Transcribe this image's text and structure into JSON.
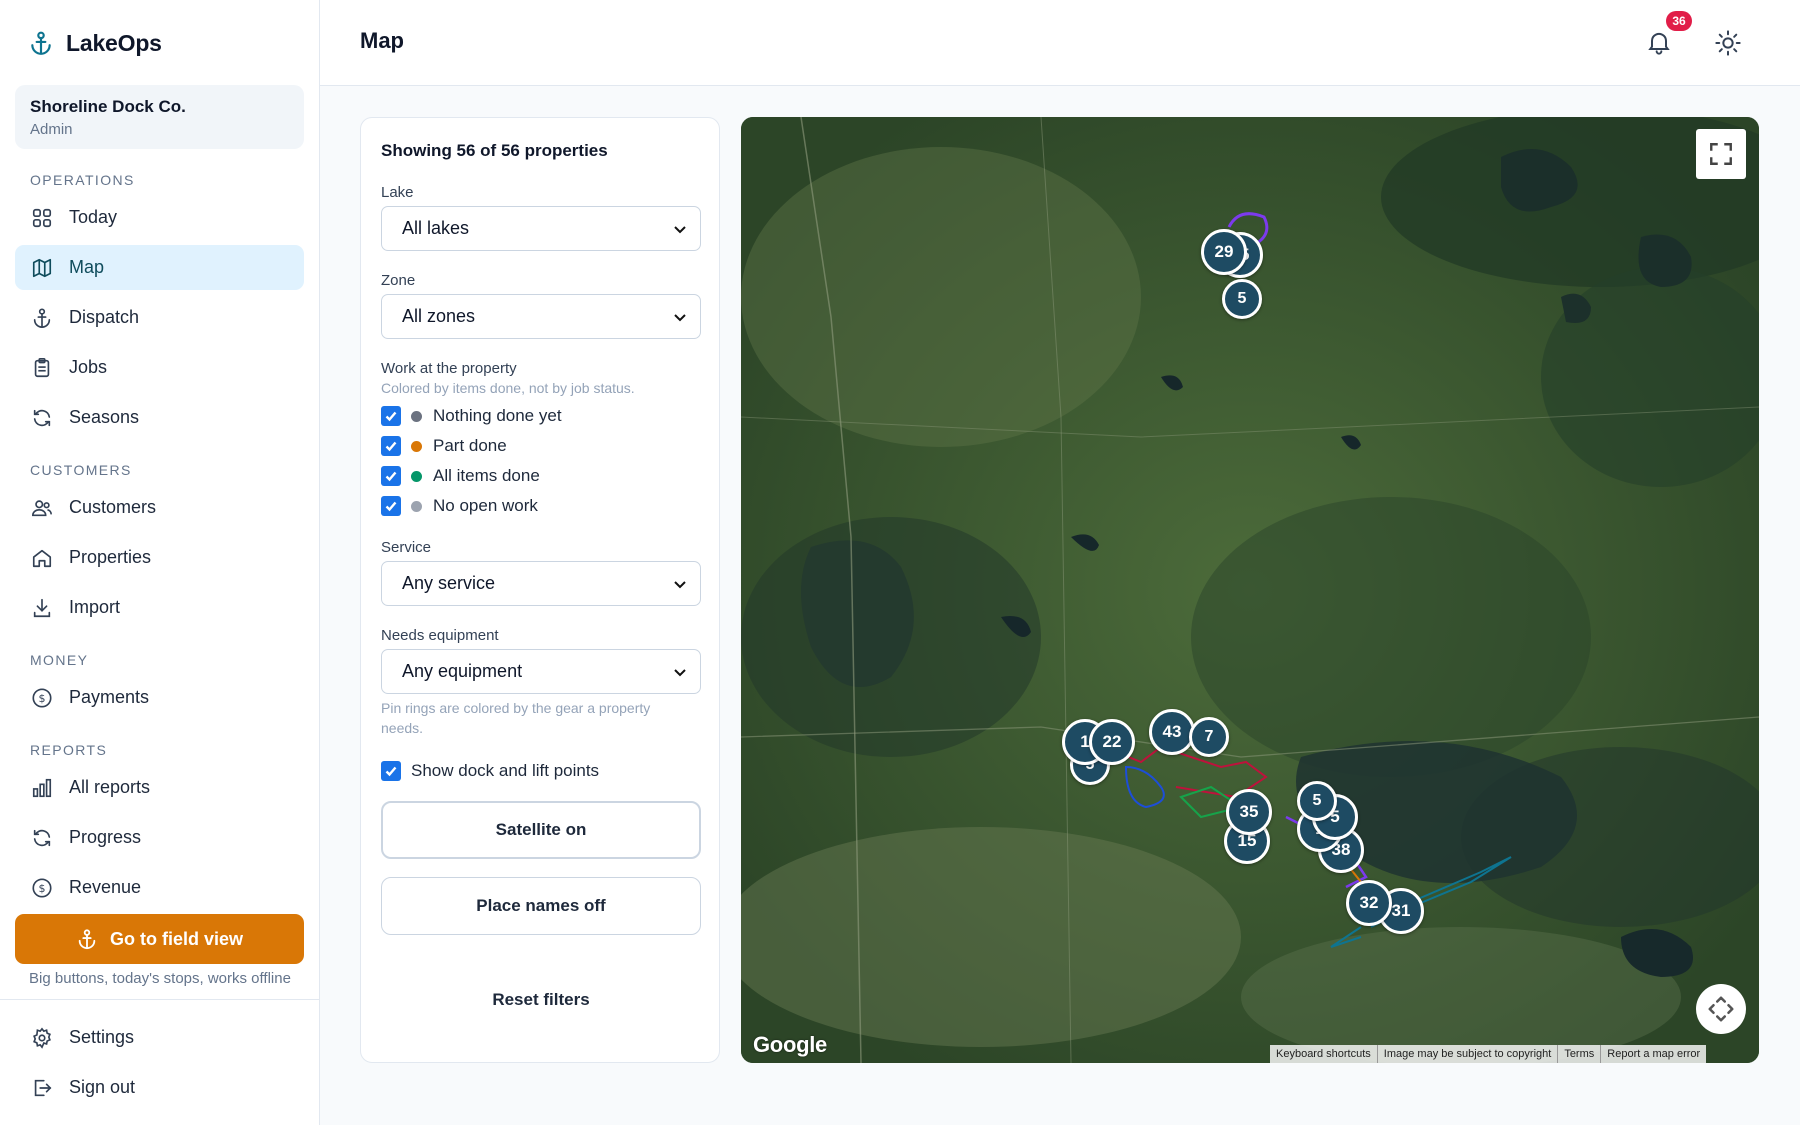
{
  "sidebar": {
    "brand": "LakeOps",
    "org": {
      "name": "Shoreline Dock Co.",
      "role": "Admin"
    },
    "sections": {
      "operations": "OPERATIONS",
      "customers": "CUSTOMERS",
      "money": "MONEY",
      "reports": "REPORTS"
    },
    "items": {
      "today": "Today",
      "map": "Map",
      "dispatch": "Dispatch",
      "jobs": "Jobs",
      "seasons": "Seasons",
      "customers": "Customers",
      "properties": "Properties",
      "import": "Import",
      "payments": "Payments",
      "all_reports": "All reports",
      "progress": "Progress",
      "revenue": "Revenue",
      "settings": "Settings",
      "sign_out": "Sign out"
    },
    "field_view_button": "Go to field view",
    "field_view_note": "Big buttons, today's stops, works offline"
  },
  "header": {
    "title": "Map",
    "notification_count": "36"
  },
  "filters": {
    "summary": "Showing 56 of 56 properties",
    "lake": {
      "label": "Lake",
      "value": "All lakes"
    },
    "zone": {
      "label": "Zone",
      "value": "All zones"
    },
    "work": {
      "label": "Work at the property",
      "hint": "Colored by items done, not by job status.",
      "options": [
        {
          "label": "Nothing done yet",
          "color": "#6b7280",
          "checked": true
        },
        {
          "label": "Part done",
          "color": "#d97706",
          "checked": true
        },
        {
          "label": "All items done",
          "color": "#059669",
          "checked": true
        },
        {
          "label": "No open work",
          "color": "#9ca3af",
          "checked": true
        }
      ]
    },
    "service": {
      "label": "Service",
      "value": "Any service"
    },
    "equipment": {
      "label": "Needs equipment",
      "value": "Any equipment",
      "hint": "Pin rings are colored by the gear a property needs."
    },
    "show_dock_points": {
      "label": "Show dock and lift points",
      "checked": true
    },
    "satellite_button": "Satellite on",
    "place_names_button": "Place names off",
    "reset_button": "Reset filters"
  },
  "map": {
    "clusters": [
      "29",
      "15",
      "5",
      "1",
      "22",
      "5",
      "43",
      "7",
      "35",
      "15",
      "5",
      "5",
      "1",
      "38",
      "32",
      "31"
    ],
    "logo": "Google",
    "attribution": [
      "Keyboard shortcuts",
      "Image may be subject to copyright",
      "Terms",
      "Report a map error"
    ]
  }
}
